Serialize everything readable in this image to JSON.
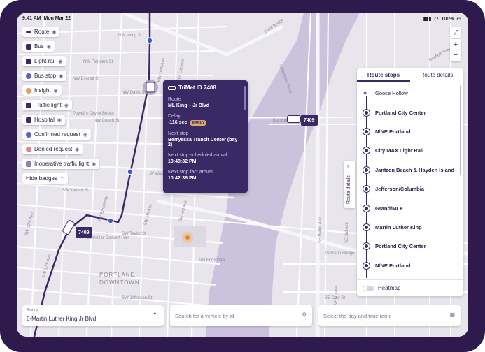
{
  "status": {
    "time": "9:41 AM",
    "date": "Mon Mar 22",
    "battery": "100%"
  },
  "filters": [
    {
      "label": "Route",
      "icon": "route-icon",
      "color": "#3b2965"
    },
    {
      "label": "Bus",
      "icon": "bus-icon",
      "color": "#3b2965"
    },
    {
      "label": "Light rail",
      "icon": "light-rail-icon",
      "color": "#3b2965"
    },
    {
      "label": "Bus stop",
      "icon": "bus-stop-icon",
      "color": "#5b5fc7"
    },
    {
      "label": "Insight",
      "icon": "insight-icon",
      "color": "#e0a25a"
    },
    {
      "label": "Traffic light",
      "icon": "traffic-light-icon",
      "color": "#3b2965"
    },
    {
      "label": "Hospital",
      "icon": "hospital-icon",
      "color": "#3b2965"
    },
    {
      "label": "Confirmed request",
      "icon": "confirmed-request-icon",
      "color": "#5b5fc7"
    },
    {
      "label": "Denied request",
      "icon": "denied-request-icon",
      "color": "#d88a8a"
    },
    {
      "label": "Inoperative traffic light",
      "icon": "inoperative-traffic-light-icon",
      "color": "#8a85a8"
    }
  ],
  "hide_badges": "Hide badges",
  "tooltip": {
    "title": "TriMet ID 7408",
    "route_label": "Route",
    "route_value": "ML King – Jr Blvd",
    "delay_label": "Delay",
    "delay_value": "-116 sec",
    "delay_badge": "EARLY",
    "next_stop_label": "Next stop",
    "next_stop_value": "Berryessa Transit Center (bay 2)",
    "sched_label": "Next stop scheduled arrival",
    "sched_value": "10:40:32 PM",
    "fact_label": "Next stop fact arrival",
    "fact_value": "10:42:38 PM"
  },
  "vehicles": [
    {
      "id": "7409"
    },
    {
      "id": "7409"
    }
  ],
  "map_labels": {
    "nw_irving": "NW Irving St",
    "nw_flanders": "NW Flanders St",
    "nw_everett": "NW Everett St",
    "nw_davis": "NW Davis St",
    "nw_couch": "NW Couch St",
    "powells": "Powell's City of Books",
    "nw_10th": "NW 10th Ave",
    "nw_11th": "NW 11th Ave",
    "steel_bridge": "Steel Bridge",
    "burnside": "Burnside",
    "nw_washington": "W Washington",
    "sw_yamhill": "SW Yamhill St",
    "sw_taylor": "SW Taylor St",
    "sw_jefferson": "SW Jefferson St",
    "portland_downtown_1": "PORTLAND",
    "portland_downtown_2": "DOWNTOWN",
    "schnitzer": "Schnitzer Concert Hall",
    "mill_ends": "Mill Ends Park",
    "willamette": "Willamette River",
    "se_morrison": "Morrison Bridge",
    "se_water": "SE Water Ave",
    "se_clay": "SE Clay St",
    "banfield": "Banfield Fwy",
    "sw_13th": "SW 13th Ave",
    "sw_12th": "SW 12th Ave",
    "sw_broadway": "SW Broadway",
    "sw_5th": "SW 5th Ave",
    "sw_3rd": "SW 3rd Ave",
    "se_6th": "SE 6th Ave",
    "se_3rd": "SE 3rd Ave"
  },
  "panel": {
    "tabs": [
      "Route stops",
      "Route details"
    ],
    "active_tab": 0,
    "stops": [
      "Goose Hollow",
      "Portland City Center",
      "N/NE Portland",
      "City MAX Light Rail",
      "Jantzen Beach & Hayden Island",
      "Jefferson/Columbia",
      "Grand/MLK",
      "Martin Luther King",
      "Portland City Center",
      "N/NE Portland"
    ],
    "heatmap_label": "Heatmap"
  },
  "route_details_tab": "Route details",
  "bottom": {
    "route_caption": "Route",
    "route_value": "6-Martin Luther King Jr Blvd",
    "search_placeholder": "Search for a vehicle by id",
    "day_placeholder": "Select the day and timeframe"
  },
  "colors": {
    "accent": "#3b2965",
    "route_line": "#3b2965",
    "river": "#c9c0dc",
    "map_bg": "#e6e4ea",
    "early_badge": "#d8a86b"
  }
}
